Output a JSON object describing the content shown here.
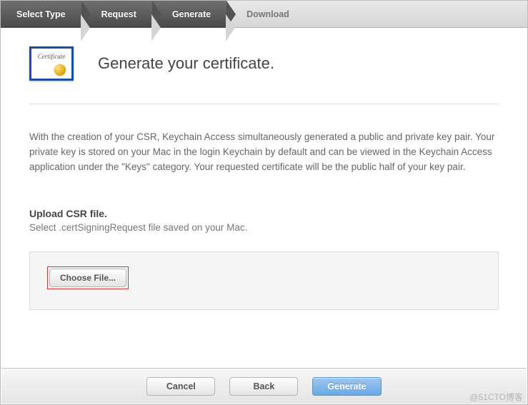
{
  "steps": {
    "select_type": "Select Type",
    "request": "Request",
    "generate": "Generate",
    "download": "Download"
  },
  "cert_icon": {
    "label": "Certificate"
  },
  "header": {
    "title": "Generate your certificate."
  },
  "body": {
    "text": "With the creation of your CSR, Keychain Access simultaneously generated a public and private key pair. Your private key is stored on your Mac in the login Keychain by default and can be viewed in the Keychain Access application under the \"Keys\" category. Your requested certificate will be the public half of your key pair."
  },
  "upload": {
    "title": "Upload CSR file.",
    "prefix": "Select ",
    "ext": ".certSigningRequest",
    "suffix": " file saved on your Mac.",
    "choose_label": "Choose File..."
  },
  "footer": {
    "cancel": "Cancel",
    "back": "Back",
    "generate": "Generate"
  },
  "watermark": "@51CTO博客"
}
